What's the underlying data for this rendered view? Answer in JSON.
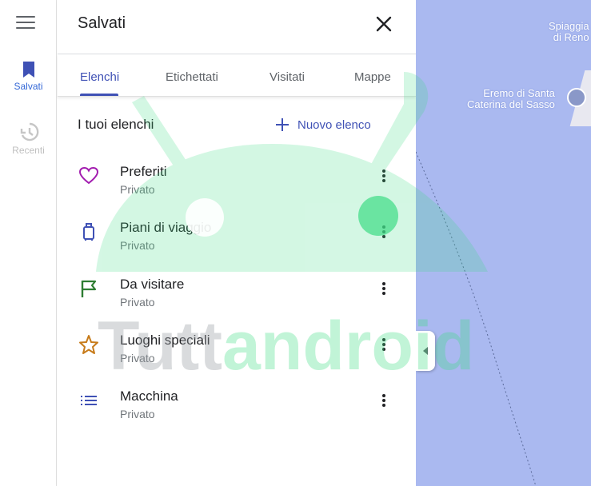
{
  "rail": {
    "saved_label": "Salvati",
    "recent_label": "Recenti"
  },
  "panel": {
    "title": "Salvati",
    "tabs": [
      {
        "label": "Elenchi",
        "active": true
      },
      {
        "label": "Etichettati",
        "active": false
      },
      {
        "label": "Visitati",
        "active": false
      },
      {
        "label": "Mappe",
        "active": false
      }
    ],
    "lists_heading": "I tuoi elenchi",
    "new_list_label": "Nuovo elenco",
    "lists": [
      {
        "name": "Preferiti",
        "visibility": "Privato",
        "icon": "heart-icon",
        "color": "#a21caf"
      },
      {
        "name": "Piani di viaggio",
        "visibility": "Privato",
        "icon": "suitcase-icon",
        "color": "#3f51b5"
      },
      {
        "name": "Da visitare",
        "visibility": "Privato",
        "icon": "flag-icon",
        "color": "#2e7d32"
      },
      {
        "name": "Luoghi speciali",
        "visibility": "Privato",
        "icon": "star-icon",
        "color": "#c77b1a"
      },
      {
        "name": "Macchina",
        "visibility": "Privato",
        "icon": "list-icon",
        "color": "#3f51b5"
      }
    ]
  },
  "map": {
    "labels": {
      "beach": "Spiaggia\ndi Reno",
      "hermitage": "Eremo di Santa\nCaterina del Sasso"
    }
  },
  "watermark": {
    "text_gray": "Tutt",
    "text_green": "android"
  },
  "colors": {
    "accent": "#3f51b5",
    "map_water": "#aab9f0",
    "watermark_green": "#3ddc84"
  }
}
